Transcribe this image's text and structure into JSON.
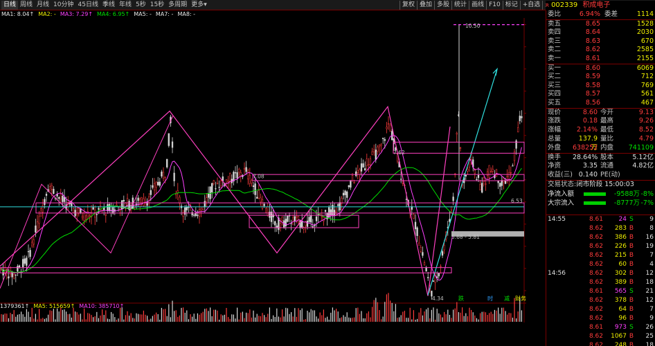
{
  "periods": [
    "日线",
    "周线",
    "月线",
    "10分钟",
    "45日线",
    "季线",
    "年线",
    "5秒",
    "15秒",
    "多周期",
    "更多▾"
  ],
  "toolbar": [
    "复权",
    "叠加",
    "多股",
    "统计",
    "画线",
    "F10",
    "标记",
    "+自选",
    "返回"
  ],
  "stock": {
    "code": "002339",
    "name": "积成电子"
  },
  "ma_line": [
    {
      "t": "MA1: 8.04↑",
      "c": "#e8e8e8"
    },
    {
      "t": "MA2: -",
      "c": "#f0f000"
    },
    {
      "t": "MA3: 7.29↑",
      "c": "#ff40ff"
    },
    {
      "t": "MA4: 6.95↑",
      "c": "#00e000"
    },
    {
      "t": "MA5: -",
      "c": "#e8e8e8"
    },
    {
      "t": "MA7: -",
      "c": "#e8e8e8"
    },
    {
      "t": "MA8: -",
      "c": "#e8e8e8"
    }
  ],
  "vol_line": [
    {
      "t": "1379361↑",
      "c": "#e8e8e8"
    },
    {
      "t": "MA5: 515659↑",
      "c": "#f0f000"
    },
    {
      "t": "MA10: 385710↑",
      "c": "#ff40ff"
    }
  ],
  "chart_data": {
    "type": "candlestick",
    "ylim": [
      4.25,
      10.65
    ],
    "yticks": [
      "10.50",
      "10.00",
      "9.50",
      "9.00",
      "8.50",
      "8.00",
      "7.50",
      "7.00",
      "6.50",
      "6.00",
      "5.50",
      "5.00",
      "4.50"
    ],
    "annotations": [
      {
        "t": "10.50",
        "x": 672,
        "y": 10.48
      },
      {
        "t": "7.62",
        "x": 568,
        "y": 7.62
      },
      {
        "t": "7.08",
        "x": 365,
        "y": 7.08
      },
      {
        "t": "6.39",
        "x": 175,
        "y": 6.39
      },
      {
        "t": "6.53",
        "x": 738,
        "y": 6.53
      },
      {
        "t": "5.68 - 5.81",
        "x": 652,
        "y": 5.72
      },
      {
        "t": "4.34",
        "x": 624,
        "y": 4.33
      }
    ],
    "markers": [
      {
        "t": "跌",
        "x": 662,
        "c": "#00e000"
      },
      {
        "t": "时",
        "x": 704,
        "c": "#30a0ff"
      },
      {
        "t": "减",
        "x": 728,
        "c": "#00e000"
      },
      {
        "t": "财务",
        "x": 744,
        "c": "#f0f000"
      }
    ],
    "vol_ticks": [
      "10000",
      "X100"
    ]
  },
  "quote": {
    "wb": {
      "label": "委比",
      "value": "6.94%",
      "label2": "委差",
      "value2": "1114"
    },
    "asks": [
      {
        "l": "卖五",
        "p": "8.65",
        "v": "1528"
      },
      {
        "l": "卖四",
        "p": "8.64",
        "v": "2030"
      },
      {
        "l": "卖三",
        "p": "8.63",
        "v": "670"
      },
      {
        "l": "卖二",
        "p": "8.62",
        "v": "2585"
      },
      {
        "l": "卖一",
        "p": "8.61",
        "v": "2155"
      }
    ],
    "bids": [
      {
        "l": "买一",
        "p": "8.60",
        "v": "6069"
      },
      {
        "l": "买二",
        "p": "8.59",
        "v": "712"
      },
      {
        "l": "买三",
        "p": "8.58",
        "v": "769"
      },
      {
        "l": "买四",
        "p": "8.57",
        "v": "561"
      },
      {
        "l": "买五",
        "p": "8.56",
        "v": "467"
      }
    ],
    "stats": [
      {
        "l1": "现价",
        "v1": "8.60",
        "c1": "red",
        "l2": "今开",
        "v2": "9.13",
        "c2": "red"
      },
      {
        "l1": "涨跌",
        "v1": "0.18",
        "c1": "red",
        "l2": "最高",
        "v2": "9.26",
        "c2": "red"
      },
      {
        "l1": "涨幅",
        "v1": "2.14%",
        "c1": "red",
        "l2": "最低",
        "v2": "8.52",
        "c2": "red"
      },
      {
        "l1": "总量",
        "v1": "137.9万",
        "c1": "yel",
        "l2": "量比",
        "v2": "4.79",
        "c2": "red"
      },
      {
        "l1": "外盘",
        "v1": "638252",
        "c1": "red",
        "l2": "内盘",
        "v2": "741109",
        "c2": "grn"
      },
      {
        "l1": "换手",
        "v1": "28.64%",
        "c1": "wht",
        "l2": "股本",
        "v2": "5.12亿",
        "c2": "wht"
      },
      {
        "l1": "净资",
        "v1": "3.35",
        "c1": "wht",
        "l2": "流通",
        "v2": "4.82亿",
        "c2": "wht"
      },
      {
        "l1": "收益(三)",
        "v1": "0.140",
        "c1": "wht",
        "l2": "PE(动)",
        "v2": "",
        "c2": "wht"
      }
    ],
    "status": {
      "label": "交易状态:",
      "value": "闭市阶段",
      "time": "15:00:03"
    },
    "flows": [
      {
        "l": "净流入额",
        "amt": "-9588万",
        "pc": "-8%"
      },
      {
        "l": "大宗流入",
        "amt": "-8777万",
        "pc": "-7%"
      }
    ]
  },
  "ticks": [
    {
      "t": "14:55",
      "p": "8.61",
      "v": "24",
      "f": "S",
      "q": "9"
    },
    {
      "t": "",
      "p": "8.62",
      "v": "283",
      "f": "B",
      "q": "8"
    },
    {
      "t": "",
      "p": "8.62",
      "v": "386",
      "f": "B",
      "q": "16"
    },
    {
      "t": "",
      "p": "8.62",
      "v": "226",
      "f": "B",
      "q": "19"
    },
    {
      "t": "",
      "p": "8.62",
      "v": "215",
      "f": "B",
      "q": "7"
    },
    {
      "t": "",
      "p": "8.62",
      "v": "60",
      "f": "B",
      "q": "4"
    },
    {
      "t": "14:56",
      "p": "8.62",
      "v": "302",
      "f": "B",
      "q": "12"
    },
    {
      "t": "",
      "p": "8.62",
      "v": "389",
      "f": "B",
      "q": "18"
    },
    {
      "t": "",
      "p": "8.61",
      "v": "565",
      "f": "S",
      "q": "21"
    },
    {
      "t": "",
      "p": "8.62",
      "v": "378",
      "f": "B",
      "q": "12"
    },
    {
      "t": "",
      "p": "8.62",
      "v": "64",
      "f": "B",
      "q": "7"
    },
    {
      "t": "",
      "p": "8.62",
      "v": "96",
      "f": "B",
      "q": "9"
    },
    {
      "t": "",
      "p": "8.61",
      "v": "973",
      "f": "S",
      "q": "26"
    },
    {
      "t": "",
      "p": "8.62",
      "v": "1067",
      "f": "B",
      "q": "25"
    },
    {
      "t": "",
      "p": "8.62",
      "v": "248",
      "f": "B",
      "q": "18"
    }
  ]
}
